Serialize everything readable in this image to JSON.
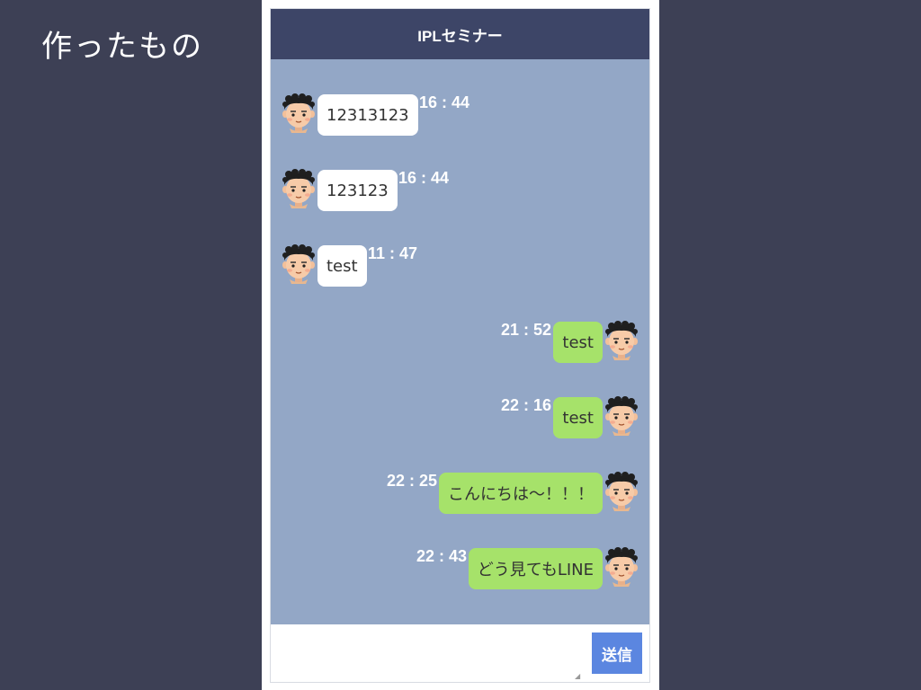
{
  "slide": {
    "title": "作ったもの"
  },
  "chat": {
    "header_title": "IPLセミナー",
    "send_label": "送信",
    "input_value": "",
    "messages": [
      {
        "side": "left",
        "text": "12313123",
        "time": "16 : 44"
      },
      {
        "side": "left",
        "text": "123123",
        "time": "16 : 44"
      },
      {
        "side": "left",
        "text": "test",
        "time": "11 : 47"
      },
      {
        "side": "right",
        "text": "test",
        "time": "21 : 52"
      },
      {
        "side": "right",
        "text": "test",
        "time": "22 : 16"
      },
      {
        "side": "right",
        "text": "こんにちは〜！！！",
        "time": "22 : 25"
      },
      {
        "side": "right",
        "text": "どう見てもLINE",
        "time": "22 : 43"
      }
    ]
  },
  "colors": {
    "slide_background": "#3d4055",
    "header_background": "#3d4567",
    "chat_background": "#93a7c6",
    "received_bubble": "#ffffff",
    "sent_bubble": "#a6e26a",
    "send_button": "#5b86e0"
  }
}
